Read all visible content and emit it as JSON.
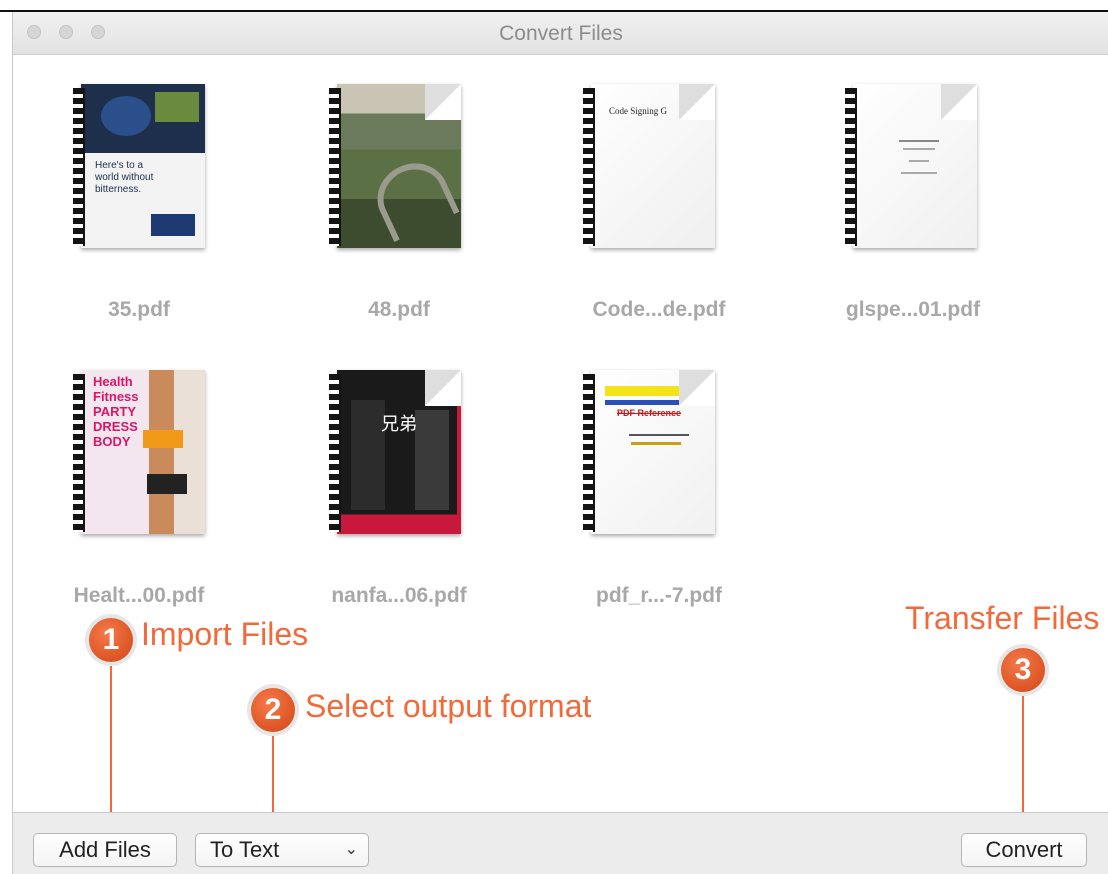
{
  "window": {
    "title": "Convert Files"
  },
  "files": [
    {
      "name": "35.pdf",
      "cover_text": "Here's to a world without bitterness."
    },
    {
      "name": "48.pdf"
    },
    {
      "name": "Code...de.pdf",
      "cover_text": "Code Signing G"
    },
    {
      "name": "glspe...01.pdf"
    },
    {
      "name": "Healt...00.pdf",
      "cover_text": "Health Fitness PARTY DRESS BODY"
    },
    {
      "name": "nanfa...06.pdf",
      "cover_text": "兄弟"
    },
    {
      "name": "pdf_r...-7.pdf",
      "cover_text": "PDF Reference"
    }
  ],
  "annotations": {
    "step1": {
      "number": "1",
      "label": "Import Files"
    },
    "step2": {
      "number": "2",
      "label": "Select output format"
    },
    "step3": {
      "number": "3",
      "label": "Transfer Files"
    }
  },
  "toolbar": {
    "add_files_label": "Add Files",
    "format_selected": "To Text",
    "convert_label": "Convert"
  },
  "colors": {
    "accent": "#f26a3a"
  },
  "icons": {
    "format_dropdown": "chevron-down-icon"
  }
}
